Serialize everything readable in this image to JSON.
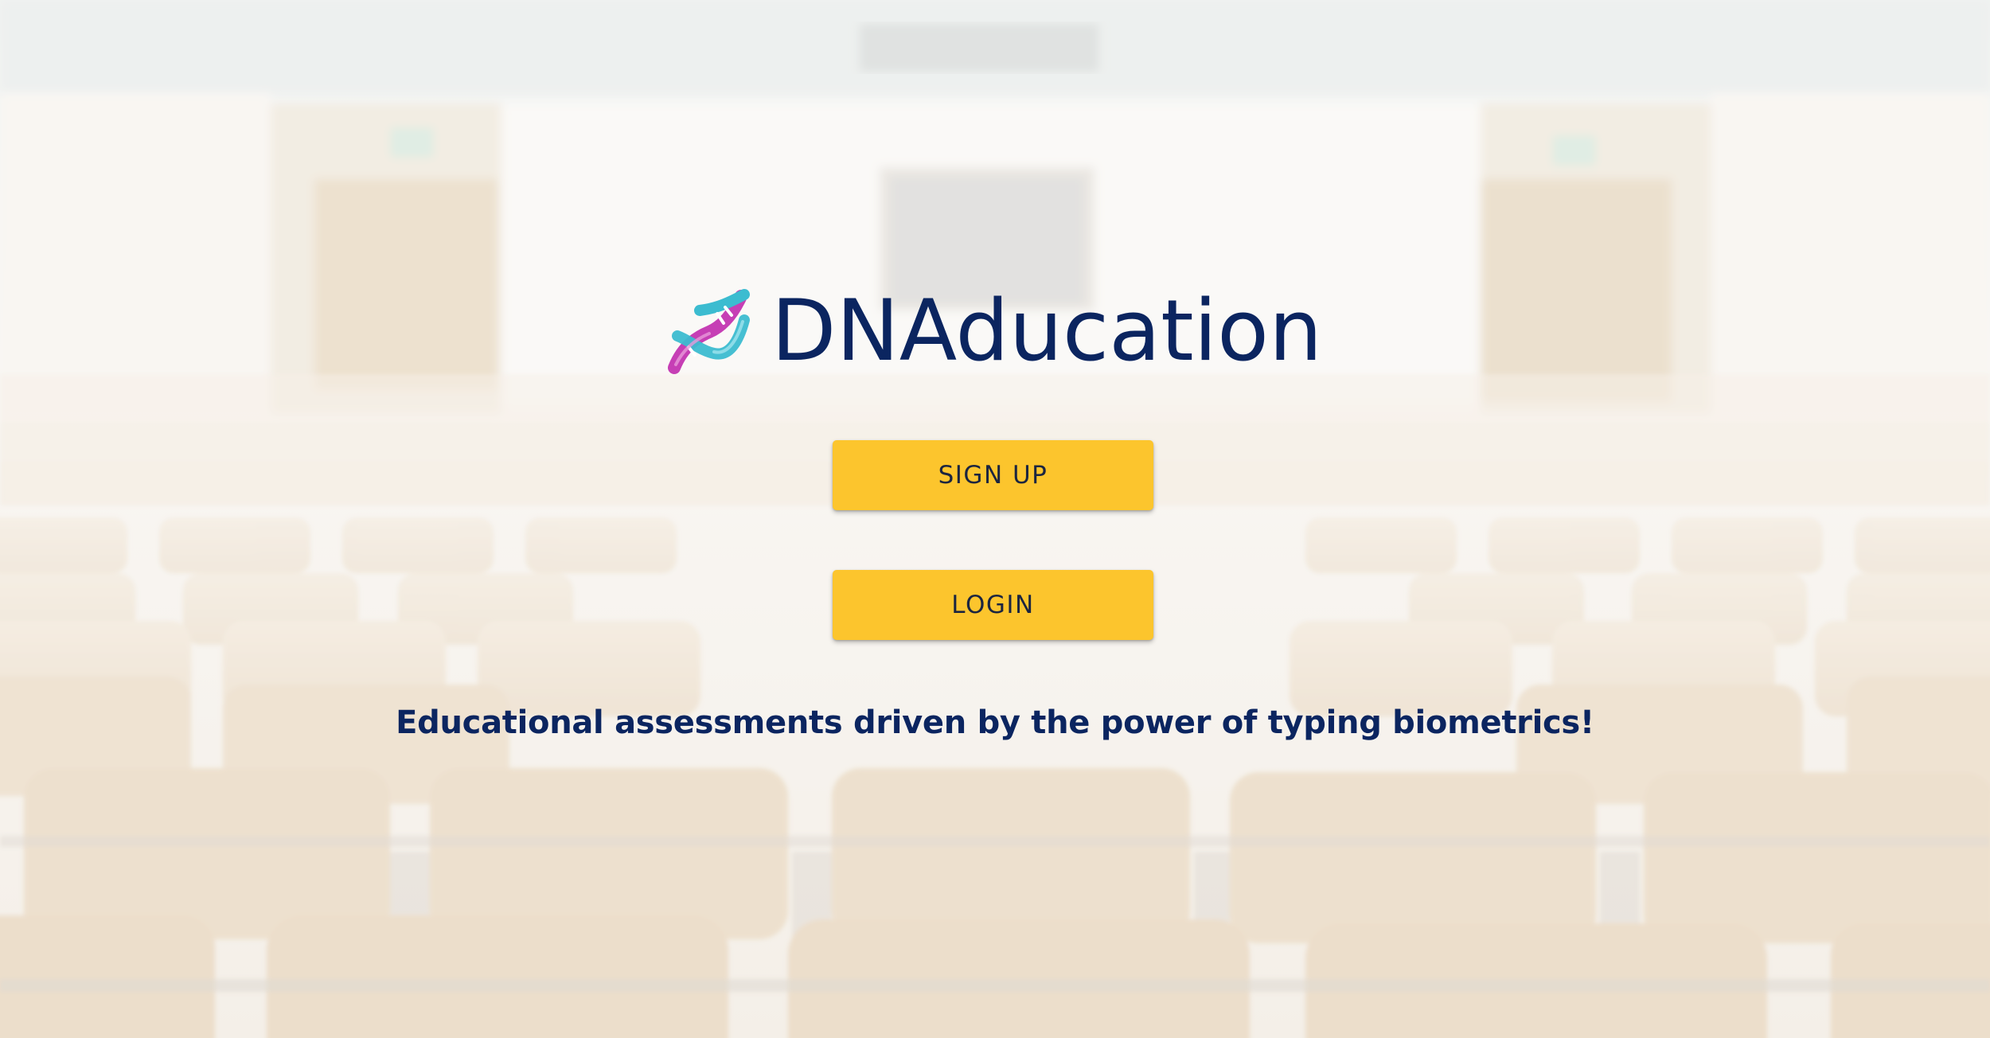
{
  "brand": {
    "title": "DNAducation",
    "icon": "dna-icon"
  },
  "actions": {
    "signup_label": "SIGN UP",
    "login_label": "LOGIN"
  },
  "tagline": "Educational assessments driven by the power of typing biometrics!",
  "colors": {
    "brand_navy": "#0b2560",
    "button_yellow": "#fcc52d",
    "button_text": "#1b2540",
    "dna_magenta": "#c63fb5",
    "dna_cyan": "#3cbcd0"
  },
  "background": {
    "description_icon": "lecture-hall-photo"
  }
}
